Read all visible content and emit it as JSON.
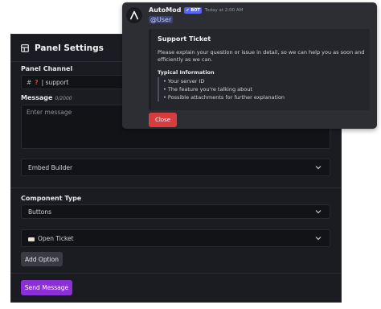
{
  "panel": {
    "title": "Panel Settings",
    "channel_label": "Panel Channel",
    "channel_prefix": "#",
    "channel_emoji": "?",
    "channel_name": "| support",
    "message_label": "Message",
    "message_counter": "0/2000",
    "message_placeholder": "Enter message",
    "embed_builder": "Embed Builder",
    "component_type_label": "Component Type",
    "component_type_value": "Buttons",
    "button_label": "Open Ticket",
    "add_option": "Add Option",
    "send_message": "Send Message"
  },
  "preview": {
    "author": "AutoMod",
    "bot_badge": "✔ BOT",
    "timestamp": "Today at 2:00 AM",
    "mention": "@User",
    "embed": {
      "title": "Support Ticket",
      "description": "Please explain your question or issue in detail, so we can help you as soon and efficiently as we can.",
      "field_name": "Typical Information",
      "items": [
        "• Your server ID",
        "• The feature you're talking about",
        "• Possible attachments for further explanation"
      ]
    },
    "close_button": "Close"
  },
  "colors": {
    "panel_bg": "#1b1c21",
    "popup_bg": "#2c2e33",
    "send_button": "#8b2fd6",
    "close_button": "#d83c3e",
    "bot_badge": "#5865f2"
  }
}
